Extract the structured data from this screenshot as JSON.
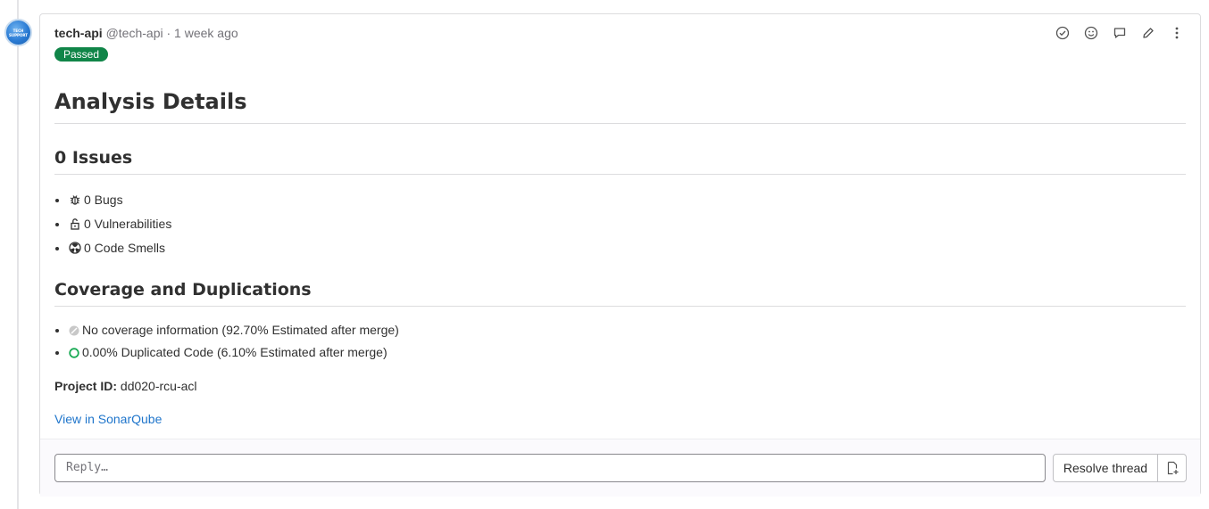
{
  "note": {
    "author": "tech-api",
    "handle_and_time": "@tech-api · 1 week ago",
    "status_badge": "Passed",
    "avatar_text": "TECH SUPPORT",
    "actions": [
      "resolve-check-icon",
      "emoji-icon",
      "comment-icon",
      "edit-icon",
      "more-options-icon"
    ]
  },
  "content": {
    "title": "Analysis Details",
    "issues_heading": "0 Issues",
    "issues": [
      {
        "icon": "bug-icon",
        "text": "0 Bugs"
      },
      {
        "icon": "lock-icon",
        "text": "0 Vulnerabilities"
      },
      {
        "icon": "code-smell-icon",
        "text": "0 Code Smells"
      }
    ],
    "coverage_heading": "Coverage and Duplications",
    "coverage": [
      {
        "icon": "no-coverage-icon",
        "text": "No coverage information (92.70% Estimated after merge)"
      },
      {
        "icon": "duplication-circle-icon",
        "text": "0.00% Duplicated Code (6.10% Estimated after merge)"
      }
    ],
    "project_label": "Project ID:",
    "project_id": "dd020-rcu-acl",
    "link_text": "View in SonarQube"
  },
  "reply": {
    "placeholder": "Reply…",
    "resolve_label": "Resolve thread"
  },
  "colors": {
    "badge_green": "#108548",
    "link_blue": "#1f75cb",
    "duplication_green": "#1aaa55"
  }
}
